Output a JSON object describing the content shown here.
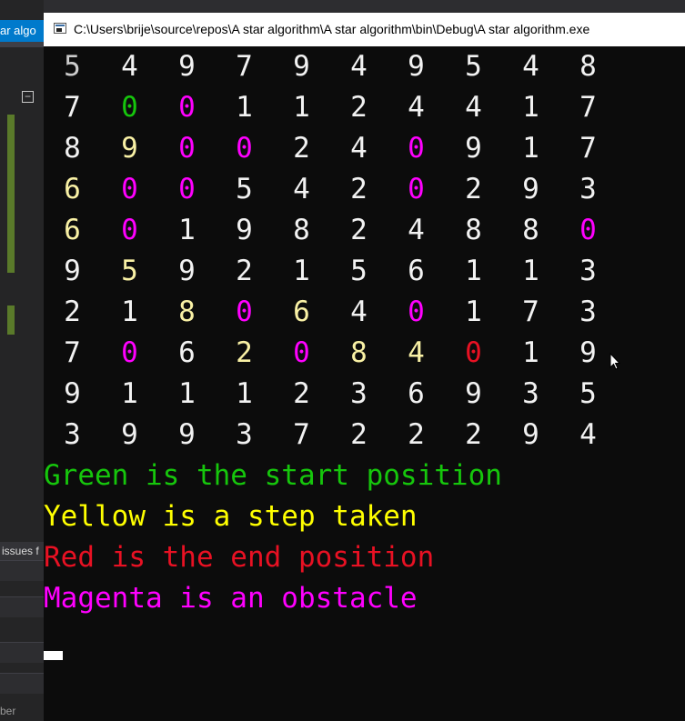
{
  "ide": {
    "tab_label": "ar algo",
    "issues_label": "issues f",
    "bottom_label": "ber",
    "collapse_symbol": "−"
  },
  "window": {
    "title": "C:\\Users\\brije\\source\\repos\\A star algorithm\\A star algorithm\\bin\\Debug\\A star algorithm.exe"
  },
  "colors": {
    "white": "#f2f2f2",
    "green": "#16c60c",
    "yellow": "#f9f1a5",
    "yellow_bright": "#ffff00",
    "red": "#e81123",
    "magenta": "#ff00ff",
    "gray": "#cccccc"
  },
  "grid": [
    [
      [
        "5",
        "gray"
      ],
      [
        "4",
        "white"
      ],
      [
        "9",
        "white"
      ],
      [
        "7",
        "white"
      ],
      [
        "9",
        "white"
      ],
      [
        "4",
        "white"
      ],
      [
        "9",
        "white"
      ],
      [
        "5",
        "white"
      ],
      [
        "4",
        "white"
      ],
      [
        "8",
        "white"
      ]
    ],
    [
      [
        "7",
        "white"
      ],
      [
        "0",
        "green"
      ],
      [
        "0",
        "magenta"
      ],
      [
        "1",
        "white"
      ],
      [
        "1",
        "white"
      ],
      [
        "2",
        "white"
      ],
      [
        "4",
        "white"
      ],
      [
        "4",
        "white"
      ],
      [
        "1",
        "white"
      ],
      [
        "7",
        "white"
      ]
    ],
    [
      [
        "8",
        "white"
      ],
      [
        "9",
        "yellow"
      ],
      [
        "0",
        "magenta"
      ],
      [
        "0",
        "magenta"
      ],
      [
        "2",
        "white"
      ],
      [
        "4",
        "white"
      ],
      [
        "0",
        "magenta"
      ],
      [
        "9",
        "white"
      ],
      [
        "1",
        "white"
      ],
      [
        "7",
        "white"
      ]
    ],
    [
      [
        "6",
        "yellow"
      ],
      [
        "0",
        "magenta"
      ],
      [
        "0",
        "magenta"
      ],
      [
        "5",
        "white"
      ],
      [
        "4",
        "white"
      ],
      [
        "2",
        "white"
      ],
      [
        "0",
        "magenta"
      ],
      [
        "2",
        "white"
      ],
      [
        "9",
        "white"
      ],
      [
        "3",
        "white"
      ]
    ],
    [
      [
        "6",
        "yellow"
      ],
      [
        "0",
        "magenta"
      ],
      [
        "1",
        "white"
      ],
      [
        "9",
        "white"
      ],
      [
        "8",
        "white"
      ],
      [
        "2",
        "white"
      ],
      [
        "4",
        "white"
      ],
      [
        "8",
        "white"
      ],
      [
        "8",
        "white"
      ],
      [
        "0",
        "magenta"
      ]
    ],
    [
      [
        "9",
        "white"
      ],
      [
        "5",
        "yellow"
      ],
      [
        "9",
        "white"
      ],
      [
        "2",
        "white"
      ],
      [
        "1",
        "white"
      ],
      [
        "5",
        "white"
      ],
      [
        "6",
        "white"
      ],
      [
        "1",
        "white"
      ],
      [
        "1",
        "white"
      ],
      [
        "3",
        "white"
      ]
    ],
    [
      [
        "2",
        "white"
      ],
      [
        "1",
        "white"
      ],
      [
        "8",
        "yellow"
      ],
      [
        "0",
        "magenta"
      ],
      [
        "6",
        "yellow"
      ],
      [
        "4",
        "white"
      ],
      [
        "0",
        "magenta"
      ],
      [
        "1",
        "white"
      ],
      [
        "7",
        "white"
      ],
      [
        "3",
        "white"
      ]
    ],
    [
      [
        "7",
        "white"
      ],
      [
        "0",
        "magenta"
      ],
      [
        "6",
        "white"
      ],
      [
        "2",
        "yellow"
      ],
      [
        "0",
        "magenta"
      ],
      [
        "8",
        "yellow"
      ],
      [
        "4",
        "yellow"
      ],
      [
        "0",
        "red"
      ],
      [
        "1",
        "white"
      ],
      [
        "9",
        "white"
      ]
    ],
    [
      [
        "9",
        "white"
      ],
      [
        "1",
        "white"
      ],
      [
        "1",
        "white"
      ],
      [
        "1",
        "white"
      ],
      [
        "2",
        "white"
      ],
      [
        "3",
        "white"
      ],
      [
        "6",
        "white"
      ],
      [
        "9",
        "white"
      ],
      [
        "3",
        "white"
      ],
      [
        "5",
        "white"
      ]
    ],
    [
      [
        "3",
        "white"
      ],
      [
        "9",
        "white"
      ],
      [
        "9",
        "white"
      ],
      [
        "3",
        "white"
      ],
      [
        "7",
        "white"
      ],
      [
        "2",
        "white"
      ],
      [
        "2",
        "white"
      ],
      [
        "2",
        "white"
      ],
      [
        "9",
        "white"
      ],
      [
        "4",
        "white"
      ]
    ]
  ],
  "legend": [
    {
      "text": "Green is the start position",
      "color": "green"
    },
    {
      "text": "Yellow is a step taken",
      "color": "yellow_bright"
    },
    {
      "text": "Red is the end position",
      "color": "red"
    },
    {
      "text": "Magenta is an obstacle",
      "color": "magenta"
    }
  ]
}
